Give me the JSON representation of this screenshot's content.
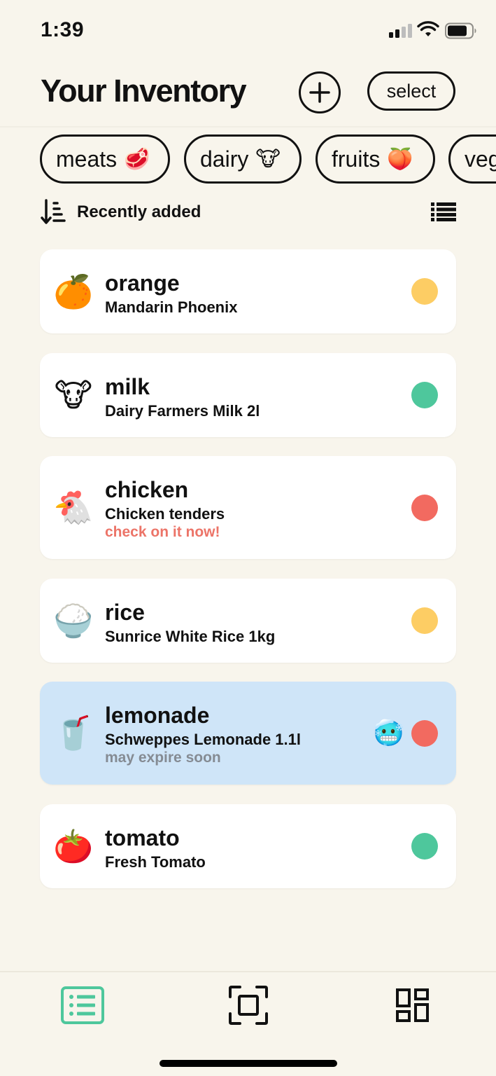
{
  "status_bar": {
    "time": "1:39"
  },
  "header": {
    "title": "Your Inventory",
    "select_label": "select"
  },
  "categories": [
    {
      "label": "meats",
      "emoji": "🥩"
    },
    {
      "label": "dairy",
      "emoji": "🐮"
    },
    {
      "label": "fruits",
      "emoji": "🍑"
    },
    {
      "label": "veg",
      "emoji": ""
    }
  ],
  "sort": {
    "label": "Recently added"
  },
  "items": [
    {
      "emoji": "🍊",
      "name": "orange",
      "description": "Mandarin Phoenix",
      "note": "",
      "status_color": "#fdcd64"
    },
    {
      "emoji": "🐮",
      "name": "milk",
      "description": "Dairy Farmers Milk 2l",
      "note": "",
      "status_color": "#4ec79c"
    },
    {
      "emoji": "🐔",
      "name": "chicken",
      "description": "Chicken tenders",
      "note": "check on it now!",
      "status_color": "#f26a60"
    },
    {
      "emoji": "🍚",
      "name": "rice",
      "description": "Sunrice White Rice 1kg",
      "note": "",
      "status_color": "#fdcd64"
    },
    {
      "emoji": "🥤",
      "name": "lemonade",
      "description": "Schweppes Lemonade 1.1l",
      "note": "may expire soon",
      "status_color": "#f26a60",
      "frozen_emoji": "🥶"
    },
    {
      "emoji": "🍅",
      "name": "tomato",
      "description": "Fresh Tomato",
      "note": "",
      "status_color": "#4ec79c"
    }
  ],
  "colors": {
    "accent": "#4ec79c",
    "background": "#f8f5ec",
    "highlight": "#cfe5f8",
    "alert": "#ec7468"
  },
  "tab_bar": {
    "icons": [
      "list-icon",
      "scan-icon",
      "grid-icon"
    ],
    "active_index": 0
  }
}
